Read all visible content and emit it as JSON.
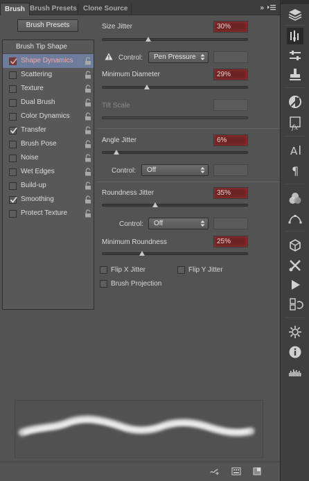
{
  "tabs": {
    "brush": "Brush",
    "brush_presets": "Brush Presets",
    "clone_source": "Clone Source",
    "menu_arrows": "»"
  },
  "presets_button": "Brush Presets",
  "left_list": {
    "tip_shape": "Brush Tip Shape",
    "items": [
      {
        "label": "Shape Dynamics",
        "checked": true,
        "selected": true
      },
      {
        "label": "Scattering",
        "checked": false,
        "selected": false
      },
      {
        "label": "Texture",
        "checked": false,
        "selected": false
      },
      {
        "label": "Dual Brush",
        "checked": false,
        "selected": false
      },
      {
        "label": "Color Dynamics",
        "checked": false,
        "selected": false
      },
      {
        "label": "Transfer",
        "checked": true,
        "selected": false
      },
      {
        "label": "Brush Pose",
        "checked": false,
        "selected": false
      },
      {
        "label": "Noise",
        "checked": false,
        "selected": false
      },
      {
        "label": "Wet Edges",
        "checked": false,
        "selected": false
      },
      {
        "label": "Build-up",
        "checked": false,
        "selected": false
      },
      {
        "label": "Smoothing",
        "checked": true,
        "selected": false
      },
      {
        "label": "Protect Texture",
        "checked": false,
        "selected": false
      }
    ]
  },
  "size_jitter": {
    "label": "Size Jitter",
    "value": "30%",
    "level": 0.3
  },
  "size_control": {
    "label": "Control:",
    "value": "Pen Pressure"
  },
  "min_diameter": {
    "label": "Minimum Diameter",
    "value": "29%",
    "level": 0.29
  },
  "tilt_scale": {
    "label": "Tilt Scale"
  },
  "angle_jitter": {
    "label": "Angle Jitter",
    "value": "6%",
    "level": 0.06
  },
  "angle_control": {
    "label": "Control:",
    "value": "Off"
  },
  "roundness_jitter": {
    "label": "Roundness Jitter",
    "value": "35%",
    "level": 0.35
  },
  "roundness_control": {
    "label": "Control:",
    "value": "Off"
  },
  "min_roundness": {
    "label": "Minimum Roundness",
    "value": "25%",
    "level": 0.25
  },
  "flip_x": "Flip X Jitter",
  "flip_y": "Flip Y Jitter",
  "brush_projection": "Brush Projection",
  "colors": {
    "panel_bg": "#535353",
    "selected_row": "#6d7c9a",
    "value_highlight": "#6a2424",
    "toolbar_bg": "#3f3f3f"
  },
  "toolbar_icons": [
    "layers-icon",
    "brush-settings-icon",
    "adjustment-sliders-icon",
    "clone-stamp-icon",
    "circle-half-icon",
    "fx-icon",
    "character-icon",
    "paragraph-icon",
    "channels-icon",
    "paths-icon",
    "3d-icon",
    "tools-icon",
    "play-icon",
    "history-icon",
    "properties-sun-icon",
    "info-icon",
    "histogram-icon"
  ]
}
